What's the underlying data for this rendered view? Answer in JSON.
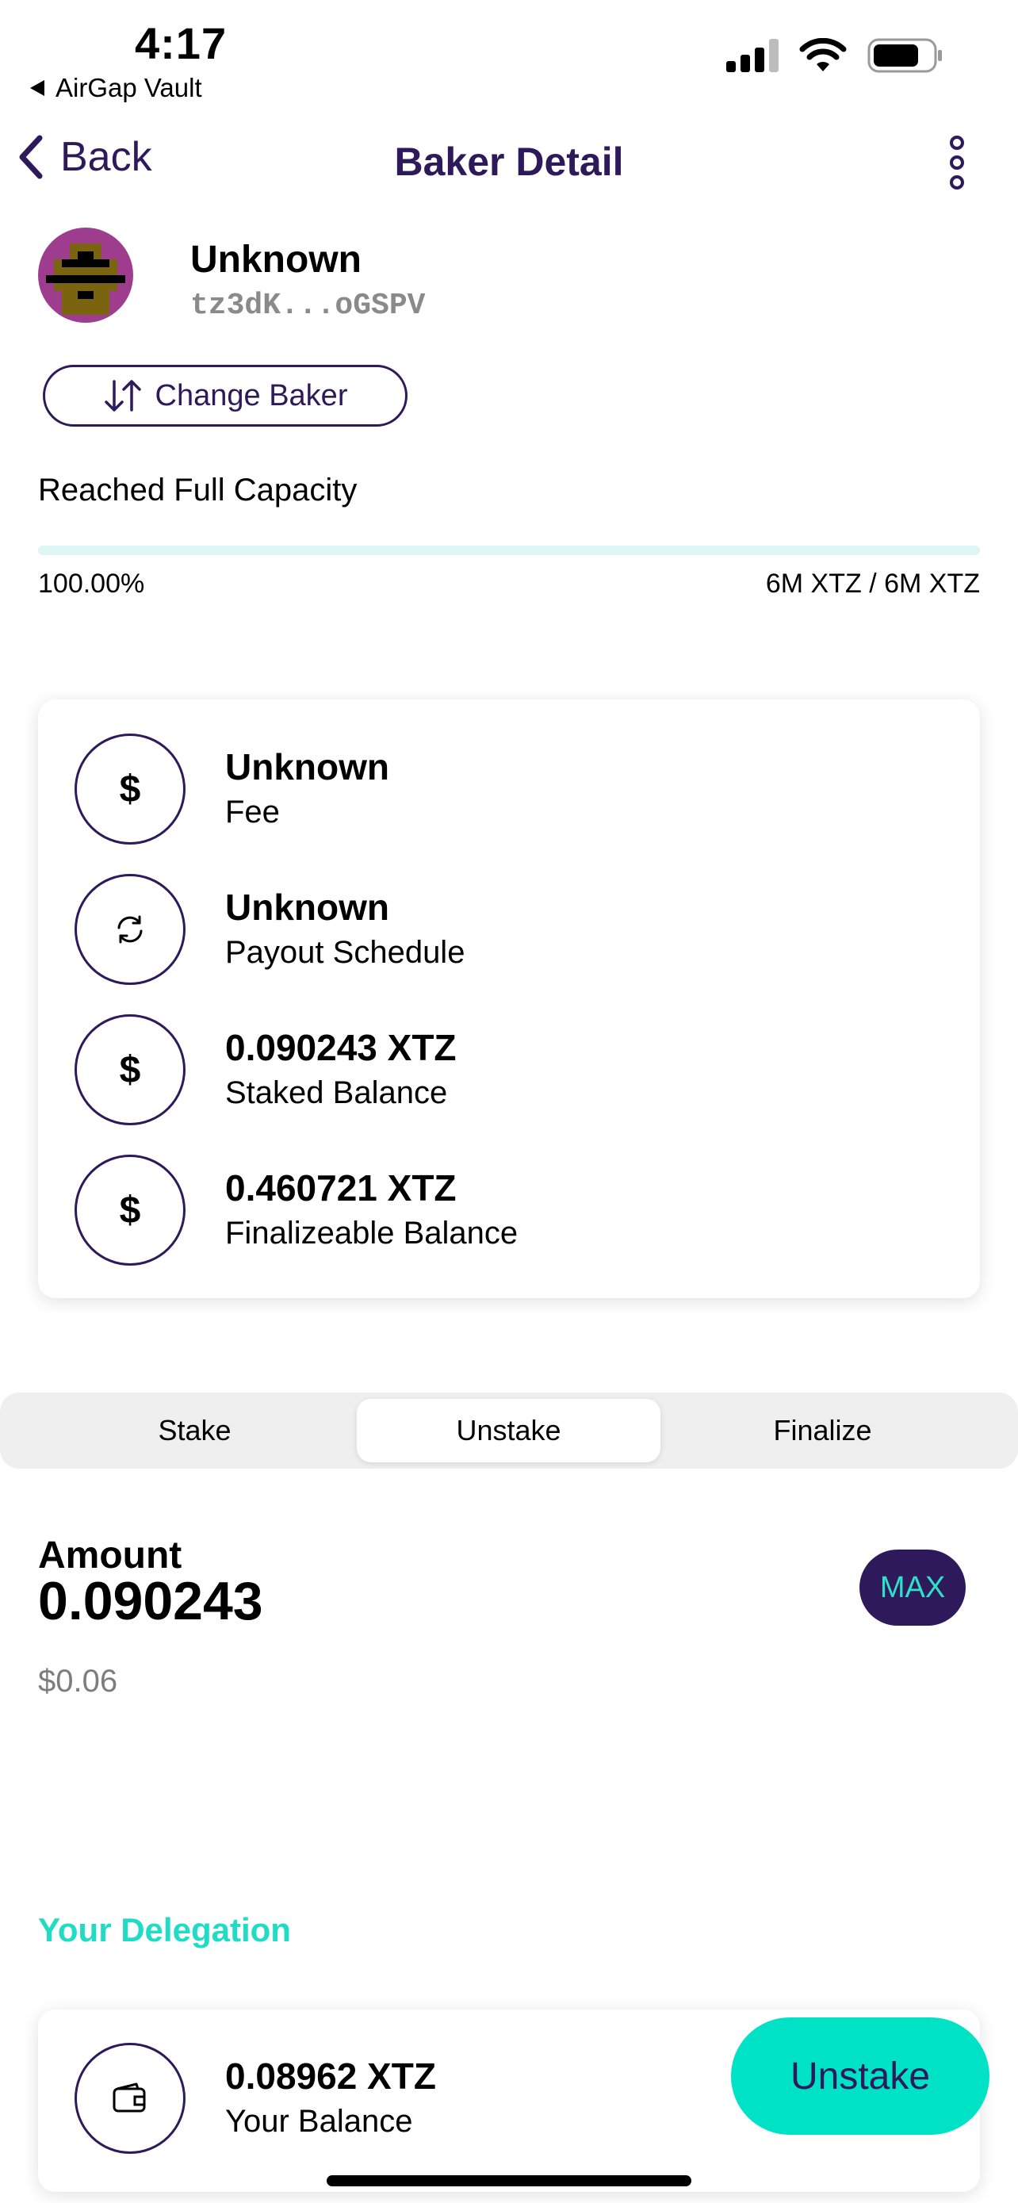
{
  "status_bar": {
    "time": "4:17",
    "back_app": "AirGap Vault",
    "icons": [
      "cellular-signal-icon",
      "wifi-icon",
      "battery-icon"
    ]
  },
  "nav": {
    "back_label": "Back",
    "title": "Baker Detail",
    "more_icon": "more-vertical-icon"
  },
  "baker": {
    "name": "Unknown",
    "address": "tz3dK...oGSPV",
    "change_label": "Change Baker"
  },
  "capacity": {
    "label": "Reached Full Capacity",
    "percent_text": "100.00%",
    "fill_fraction": 1.0,
    "amount_text": "6M XTZ / 6M XTZ"
  },
  "info": [
    {
      "value": "Unknown",
      "label": "Fee",
      "icon": "dollar-icon"
    },
    {
      "value": "Unknown",
      "label": "Payout Schedule",
      "icon": "refresh-icon"
    },
    {
      "value": "0.090243 XTZ",
      "label": "Staked Balance",
      "icon": "dollar-icon"
    },
    {
      "value": "0.460721 XTZ",
      "label": "Finalizeable Balance",
      "icon": "dollar-icon"
    }
  ],
  "tabs": {
    "items": [
      "Stake",
      "Unstake",
      "Finalize"
    ],
    "selected": "Unstake"
  },
  "amount": {
    "label": "Amount",
    "value": "0.090243",
    "fiat": "$0.06",
    "max_label": "MAX"
  },
  "delegation": {
    "title": "Your Delegation",
    "balance": "0.08962 XTZ",
    "balance_label": "Your Balance",
    "action_label": "Unstake"
  },
  "colors": {
    "primary": "#2e1a5a",
    "accent": "#00e2c5",
    "accent_text": "#1fdcc4",
    "muted": "#7d7d7d"
  }
}
